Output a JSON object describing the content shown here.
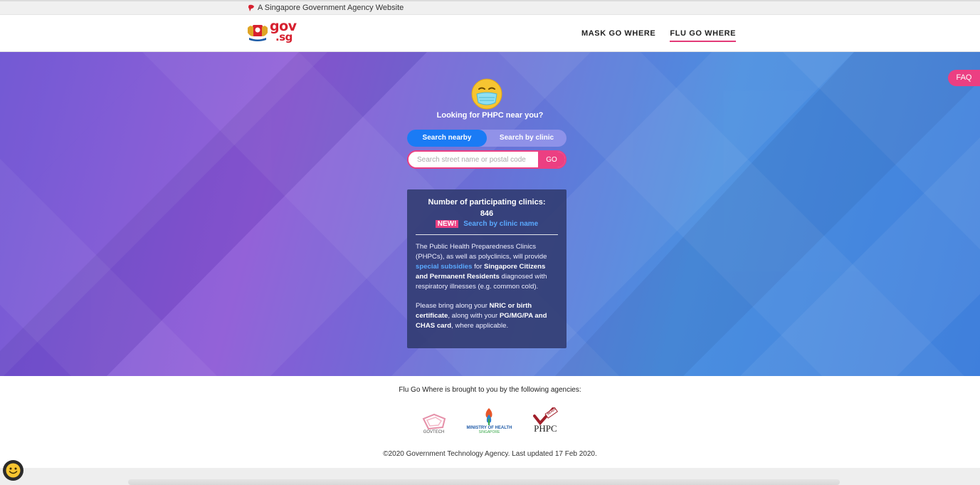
{
  "masthead": {
    "text": "A Singapore Government Agency Website"
  },
  "navbar": {
    "logo_text": "gov",
    "logo_suffix": ".sg",
    "links": [
      {
        "label": "MASK GO WHERE",
        "active": false
      },
      {
        "label": "FLU GO WHERE",
        "active": true
      }
    ]
  },
  "hero": {
    "faq_label": "FAQ",
    "title": "Looking for PHPC near you?",
    "tabs": [
      {
        "label": "Search nearby",
        "active": true
      },
      {
        "label": "Search by clinic",
        "active": false
      }
    ],
    "search": {
      "placeholder": "Search street name or postal code",
      "value": "",
      "go_label": "GO"
    }
  },
  "info_card": {
    "count_label": "Number of participating clinics:",
    "count_value": "846",
    "new_badge": "NEW!",
    "new_link": "Search by clinic name",
    "para1": {
      "part1": "The Public Health Preparedness Clinics (PHPCs), as well as polyclinics, will provide ",
      "link": "special subsidies",
      "part2": " for ",
      "bold": "Singapore Citizens and Permanent Residents",
      "part3": " diagnosed with respiratory illnesses (e.g. common cold)."
    },
    "para2": {
      "part1": "Please bring along your ",
      "bold1": "NRIC or birth certificate",
      "part2": ", along with your ",
      "bold2": "PG/MG/PA and CHAS card",
      "part3": ", where applicable."
    }
  },
  "footer": {
    "title": "Flu Go Where is brought to you by the following agencies:",
    "agencies": [
      {
        "name": "GOVTECH"
      },
      {
        "name": "MINISTRY OF HEALTH",
        "sub": "SINGAPORE"
      },
      {
        "name": "PHPC",
        "badge": "READY"
      }
    ],
    "copyright": "©2020 Government Technology Agency. Last updated 17 Feb 2020."
  },
  "colors": {
    "accent": "#ec3f82",
    "primary_blue": "#1a7bf5",
    "link_blue": "#5aa9ff",
    "gov_red": "#d6202f"
  },
  "icons": [
    "lion-head-icon",
    "singapore-crest-icon",
    "face-mask-emoji-icon",
    "smiley-chat-icon"
  ]
}
